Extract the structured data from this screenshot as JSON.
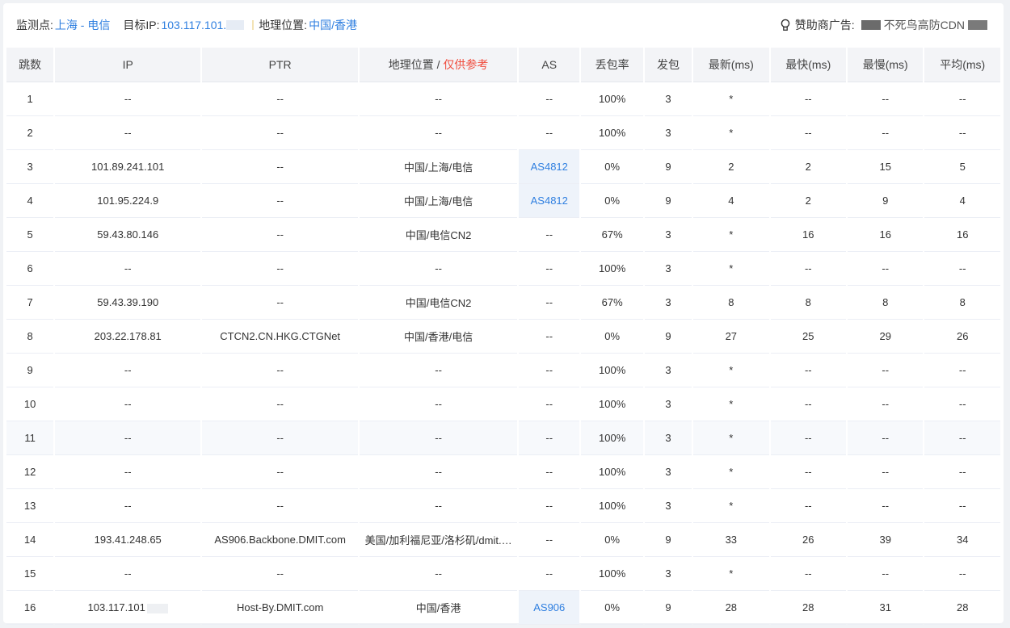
{
  "header": {
    "monitor_label": "监测点:",
    "monitor_value": "上海 - 电信",
    "target_label": "目标IP:",
    "target_value": "103.117.101.",
    "geo_label": "地理位置:",
    "geo_value": "中国/香港",
    "sponsor_label": "赞助商广告:",
    "sponsor_text": "不死鸟高防CDN"
  },
  "columns": {
    "hop": "跳数",
    "ip": "IP",
    "ptr": "PTR",
    "geo": "地理位置",
    "geo_sep": " / ",
    "geo_note": "仅供参考",
    "as": "AS",
    "loss": "丢包率",
    "sent": "发包",
    "last": "最新(ms)",
    "best": "最快(ms)",
    "worst": "最慢(ms)",
    "avg": "平均(ms)"
  },
  "rows": [
    {
      "hop": "1",
      "ip": "--",
      "ptr": "--",
      "geo": "--",
      "as": "--",
      "loss": "100%",
      "sent": "3",
      "last": "*",
      "best": "--",
      "worst": "--",
      "avg": "--"
    },
    {
      "hop": "2",
      "ip": "--",
      "ptr": "--",
      "geo": "--",
      "as": "--",
      "loss": "100%",
      "sent": "3",
      "last": "*",
      "best": "--",
      "worst": "--",
      "avg": "--"
    },
    {
      "hop": "3",
      "ip": "101.89.241.101",
      "ptr": "--",
      "geo": "中国/上海/电信",
      "as": "AS4812",
      "loss": "0%",
      "sent": "9",
      "last": "2",
      "best": "2",
      "worst": "15",
      "avg": "5"
    },
    {
      "hop": "4",
      "ip": "101.95.224.9",
      "ptr": "--",
      "geo": "中国/上海/电信",
      "as": "AS4812",
      "loss": "0%",
      "sent": "9",
      "last": "4",
      "best": "2",
      "worst": "9",
      "avg": "4"
    },
    {
      "hop": "5",
      "ip": "59.43.80.146",
      "ptr": "--",
      "geo": "中国/电信CN2",
      "as": "--",
      "loss": "67%",
      "sent": "3",
      "last": "*",
      "best": "16",
      "worst": "16",
      "avg": "16"
    },
    {
      "hop": "6",
      "ip": "--",
      "ptr": "--",
      "geo": "--",
      "as": "--",
      "loss": "100%",
      "sent": "3",
      "last": "*",
      "best": "--",
      "worst": "--",
      "avg": "--"
    },
    {
      "hop": "7",
      "ip": "59.43.39.190",
      "ptr": "--",
      "geo": "中国/电信CN2",
      "as": "--",
      "loss": "67%",
      "sent": "3",
      "last": "8",
      "best": "8",
      "worst": "8",
      "avg": "8"
    },
    {
      "hop": "8",
      "ip": "203.22.178.81",
      "ptr": "CTCN2.CN.HKG.CTGNet",
      "geo": "中国/香港/电信",
      "as": "--",
      "loss": "0%",
      "sent": "9",
      "last": "27",
      "best": "25",
      "worst": "29",
      "avg": "26"
    },
    {
      "hop": "9",
      "ip": "--",
      "ptr": "--",
      "geo": "--",
      "as": "--",
      "loss": "100%",
      "sent": "3",
      "last": "*",
      "best": "--",
      "worst": "--",
      "avg": "--"
    },
    {
      "hop": "10",
      "ip": "--",
      "ptr": "--",
      "geo": "--",
      "as": "--",
      "loss": "100%",
      "sent": "3",
      "last": "*",
      "best": "--",
      "worst": "--",
      "avg": "--"
    },
    {
      "hop": "11",
      "ip": "--",
      "ptr": "--",
      "geo": "--",
      "as": "--",
      "loss": "100%",
      "sent": "3",
      "last": "*",
      "best": "--",
      "worst": "--",
      "avg": "--"
    },
    {
      "hop": "12",
      "ip": "--",
      "ptr": "--",
      "geo": "--",
      "as": "--",
      "loss": "100%",
      "sent": "3",
      "last": "*",
      "best": "--",
      "worst": "--",
      "avg": "--"
    },
    {
      "hop": "13",
      "ip": "--",
      "ptr": "--",
      "geo": "--",
      "as": "--",
      "loss": "100%",
      "sent": "3",
      "last": "*",
      "best": "--",
      "worst": "--",
      "avg": "--"
    },
    {
      "hop": "14",
      "ip": "193.41.248.65",
      "ptr": "AS906.Backbone.DMIT.com",
      "geo": "美国/加利福尼亚/洛杉矶/dmit.…",
      "as": "--",
      "loss": "0%",
      "sent": "9",
      "last": "33",
      "best": "26",
      "worst": "39",
      "avg": "34"
    },
    {
      "hop": "15",
      "ip": "--",
      "ptr": "--",
      "geo": "--",
      "as": "--",
      "loss": "100%",
      "sent": "3",
      "last": "*",
      "best": "--",
      "worst": "--",
      "avg": "--"
    },
    {
      "hop": "16",
      "ip": "103.117.101",
      "ptr": "Host-By.DMIT.com",
      "geo": "中国/香港",
      "as": "AS906",
      "loss": "0%",
      "sent": "9",
      "last": "28",
      "best": "28",
      "worst": "31",
      "avg": "28"
    }
  ]
}
